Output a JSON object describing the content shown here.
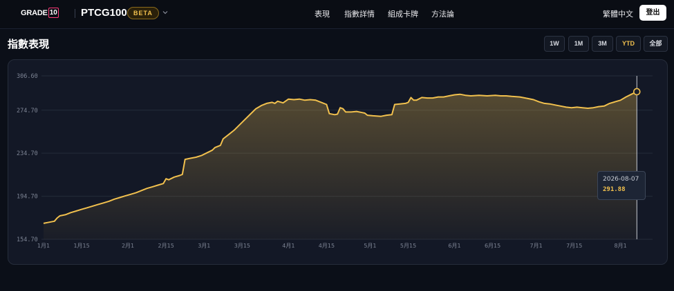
{
  "header": {
    "brand_text": "GRADE",
    "brand_num": "10",
    "product": "PTCG100",
    "badge": "BETA",
    "nav": [
      "表現",
      "指數詳情",
      "組成卡牌",
      "方法論"
    ],
    "language": "繁體中文",
    "logout": "登出"
  },
  "page": {
    "title": "指數表現"
  },
  "ranges": {
    "options": [
      "1W",
      "1M",
      "3M",
      "YTD",
      "全部"
    ],
    "selected": "YTD"
  },
  "tooltip": {
    "date": "2026-08-07",
    "value": "291.88"
  },
  "colors": {
    "accent": "#f2c14e",
    "background": "#0b0f18",
    "card": "#131826"
  },
  "chart_data": {
    "type": "area",
    "title": "",
    "xlabel": "",
    "ylabel": "",
    "ylim": [
      154.7,
      306.6
    ],
    "y_ticks": [
      "306.60",
      "274.70",
      "234.70",
      "194.70",
      "154.70"
    ],
    "x_ticks": [
      {
        "label": "1月1",
        "day": 0
      },
      {
        "label": "1月15",
        "day": 14
      },
      {
        "label": "2月1",
        "day": 31
      },
      {
        "label": "2月15",
        "day": 45
      },
      {
        "label": "3月1",
        "day": 59
      },
      {
        "label": "3月15",
        "day": 73
      },
      {
        "label": "4月1",
        "day": 90
      },
      {
        "label": "4月15",
        "day": 104
      },
      {
        "label": "5月1",
        "day": 120
      },
      {
        "label": "5月15",
        "day": 134
      },
      {
        "label": "6月1",
        "day": 151
      },
      {
        "label": "6月15",
        "day": 165
      },
      {
        "label": "7月1",
        "day": 181
      },
      {
        "label": "7月15",
        "day": 195
      },
      {
        "label": "8月1",
        "day": 212
      }
    ],
    "series": [
      {
        "points": [
          [
            0,
            169.5
          ],
          [
            2,
            170.5
          ],
          [
            4,
            171.5
          ],
          [
            5,
            174.5
          ],
          [
            6,
            176.5
          ],
          [
            8,
            177.5
          ],
          [
            10,
            179.5
          ],
          [
            12,
            181
          ],
          [
            14,
            182.5
          ],
          [
            16,
            184
          ],
          [
            18,
            185.5
          ],
          [
            20,
            187
          ],
          [
            22,
            188.5
          ],
          [
            24,
            190
          ],
          [
            26,
            192
          ],
          [
            28,
            193.5
          ],
          [
            30,
            195
          ],
          [
            32,
            196.5
          ],
          [
            34,
            198
          ],
          [
            36,
            200
          ],
          [
            38,
            202
          ],
          [
            40,
            203.5
          ],
          [
            42,
            205
          ],
          [
            44,
            206.5
          ],
          [
            45,
            211
          ],
          [
            46,
            210
          ],
          [
            48,
            212.5
          ],
          [
            50,
            214
          ],
          [
            51,
            215
          ],
          [
            52,
            229
          ],
          [
            54,
            230
          ],
          [
            56,
            231
          ],
          [
            58,
            232.5
          ],
          [
            60,
            235
          ],
          [
            62,
            237.5
          ],
          [
            63,
            240
          ],
          [
            65,
            242
          ],
          [
            66,
            248
          ],
          [
            68,
            252
          ],
          [
            70,
            256
          ],
          [
            72,
            261
          ],
          [
            74,
            266
          ],
          [
            76,
            271
          ],
          [
            78,
            276
          ],
          [
            80,
            279
          ],
          [
            82,
            281
          ],
          [
            84,
            282
          ],
          [
            85,
            281
          ],
          [
            86,
            283
          ],
          [
            88,
            281.5
          ],
          [
            90,
            285
          ],
          [
            92,
            284.5
          ],
          [
            94,
            285
          ],
          [
            96,
            284
          ],
          [
            98,
            284.5
          ],
          [
            100,
            284
          ],
          [
            102,
            282
          ],
          [
            104,
            280
          ],
          [
            105,
            271.5
          ],
          [
            107,
            270.5
          ],
          [
            108,
            271
          ],
          [
            109,
            277
          ],
          [
            110,
            276
          ],
          [
            111,
            273
          ],
          [
            113,
            273
          ],
          [
            115,
            273.5
          ],
          [
            117,
            272.5
          ],
          [
            118,
            272
          ],
          [
            119,
            270
          ],
          [
            121,
            269.5
          ],
          [
            124,
            269
          ],
          [
            126,
            270
          ],
          [
            128,
            270.5
          ],
          [
            129,
            280
          ],
          [
            131,
            280.5
          ],
          [
            133,
            281
          ],
          [
            134,
            282
          ],
          [
            135,
            286.5
          ],
          [
            136,
            284
          ],
          [
            137,
            284
          ],
          [
            139,
            286.5
          ],
          [
            141,
            286
          ],
          [
            143,
            286
          ],
          [
            145,
            287
          ],
          [
            147,
            287
          ],
          [
            149,
            288
          ],
          [
            151,
            289
          ],
          [
            153,
            289.5
          ],
          [
            155,
            288.5
          ],
          [
            157,
            288
          ],
          [
            160,
            288.5
          ],
          [
            163,
            288
          ],
          [
            166,
            288.5
          ],
          [
            168,
            288
          ],
          [
            170,
            288
          ],
          [
            172,
            287.5
          ],
          [
            175,
            287
          ],
          [
            177,
            286
          ],
          [
            180,
            284.5
          ],
          [
            182,
            282.5
          ],
          [
            184,
            281
          ],
          [
            186,
            280.5
          ],
          [
            188,
            279.5
          ],
          [
            190,
            278.5
          ],
          [
            192,
            277.5
          ],
          [
            194,
            277
          ],
          [
            196,
            277.5
          ],
          [
            198,
            277
          ],
          [
            200,
            276.5
          ],
          [
            202,
            277
          ],
          [
            204,
            278
          ],
          [
            206,
            278.5
          ],
          [
            208,
            281
          ],
          [
            210,
            282.5
          ],
          [
            212,
            284
          ],
          [
            214,
            287
          ],
          [
            216,
            289.5
          ],
          [
            218,
            291.9
          ]
        ]
      }
    ],
    "highlight": {
      "day": 218,
      "value": 291.88
    }
  }
}
